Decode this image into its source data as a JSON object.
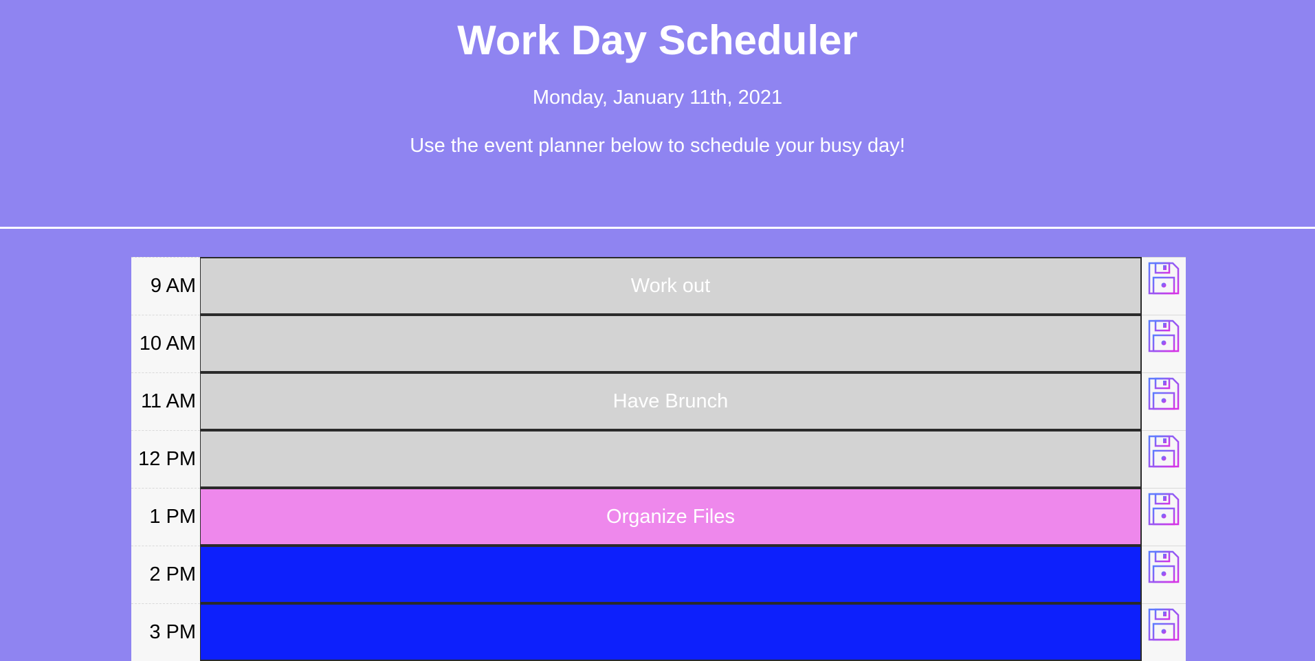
{
  "header": {
    "title": "Work Day Scheduler",
    "date": "Monday, January 11th, 2021",
    "lead": "Use the event planner below to schedule your busy day!"
  },
  "colors": {
    "background": "#8f84f1",
    "past": "#d3d3d3",
    "present": "#ee88ec",
    "future": "#0d20fc"
  },
  "rows": [
    {
      "hour": "9 AM",
      "text": "Work out",
      "status": "past",
      "save_icon": "floppy-disk-icon"
    },
    {
      "hour": "10 AM",
      "text": "",
      "status": "past",
      "save_icon": "floppy-disk-icon"
    },
    {
      "hour": "11 AM",
      "text": "Have Brunch",
      "status": "past",
      "save_icon": "floppy-disk-icon"
    },
    {
      "hour": "12 PM",
      "text": "",
      "status": "past",
      "save_icon": "floppy-disk-icon"
    },
    {
      "hour": "1 PM",
      "text": "Organize Files",
      "status": "present",
      "save_icon": "floppy-disk-icon"
    },
    {
      "hour": "2 PM",
      "text": "",
      "status": "future",
      "save_icon": "floppy-disk-icon"
    },
    {
      "hour": "3 PM",
      "text": "",
      "status": "future",
      "save_icon": "floppy-disk-icon"
    }
  ]
}
